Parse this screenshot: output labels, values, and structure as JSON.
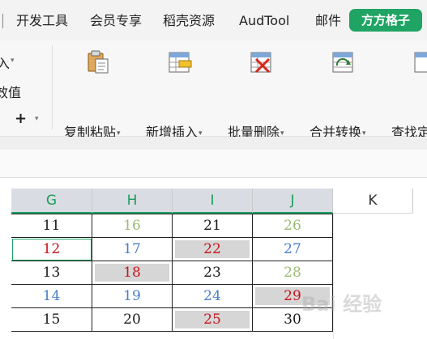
{
  "menu": {
    "items": [
      "开发工具",
      "会员专享",
      "稻壳资源",
      "AudTool",
      "邮件"
    ],
    "active": "方方格子",
    "colors": {
      "active_bg": "#1fa463",
      "active_text": "#ffffff"
    }
  },
  "ribbon": {
    "left_partial": [
      "入",
      "效值",
      "+"
    ],
    "tools": [
      {
        "label": "复制粘贴",
        "icon": "clipboard-paste-icon"
      },
      {
        "label": "新增插入",
        "icon": "insert-table-icon"
      },
      {
        "label": "批量删除",
        "icon": "delete-table-icon"
      },
      {
        "label": "合并转换",
        "icon": "merge-convert-icon"
      },
      {
        "label": "查找定",
        "icon": "find-icon"
      }
    ],
    "dropdown_glyph": "▾"
  },
  "grid": {
    "columns": [
      "G",
      "H",
      "I",
      "J",
      "K"
    ],
    "selected_columns": [
      "G",
      "H",
      "I",
      "J"
    ],
    "colors": {
      "black": "#1a1a1a",
      "green": "#9bbb73",
      "red": "#c8141b",
      "blue": "#4a7fc8",
      "gray_fill": "#d6d6d6",
      "accent": "#1fa463"
    },
    "rows": [
      [
        {
          "v": "11",
          "c": "black"
        },
        {
          "v": "16",
          "c": "green"
        },
        {
          "v": "21",
          "c": "black"
        },
        {
          "v": "26",
          "c": "green"
        }
      ],
      [
        {
          "v": "12",
          "c": "red"
        },
        {
          "v": "17",
          "c": "blue"
        },
        {
          "v": "22",
          "c": "red",
          "gray": true
        },
        {
          "v": "27",
          "c": "blue"
        }
      ],
      [
        {
          "v": "13",
          "c": "black"
        },
        {
          "v": "18",
          "c": "red",
          "gray": true
        },
        {
          "v": "23",
          "c": "black"
        },
        {
          "v": "28",
          "c": "green"
        }
      ],
      [
        {
          "v": "14",
          "c": "blue"
        },
        {
          "v": "19",
          "c": "blue"
        },
        {
          "v": "24",
          "c": "blue"
        },
        {
          "v": "29",
          "c": "red",
          "gray": true
        }
      ],
      [
        {
          "v": "15",
          "c": "black"
        },
        {
          "v": "20",
          "c": "black"
        },
        {
          "v": "25",
          "c": "red",
          "gray": true
        },
        {
          "v": "30",
          "c": "black"
        }
      ]
    ],
    "active_cell": {
      "row": 1,
      "col": 0
    }
  },
  "watermark": "Bai 经验"
}
